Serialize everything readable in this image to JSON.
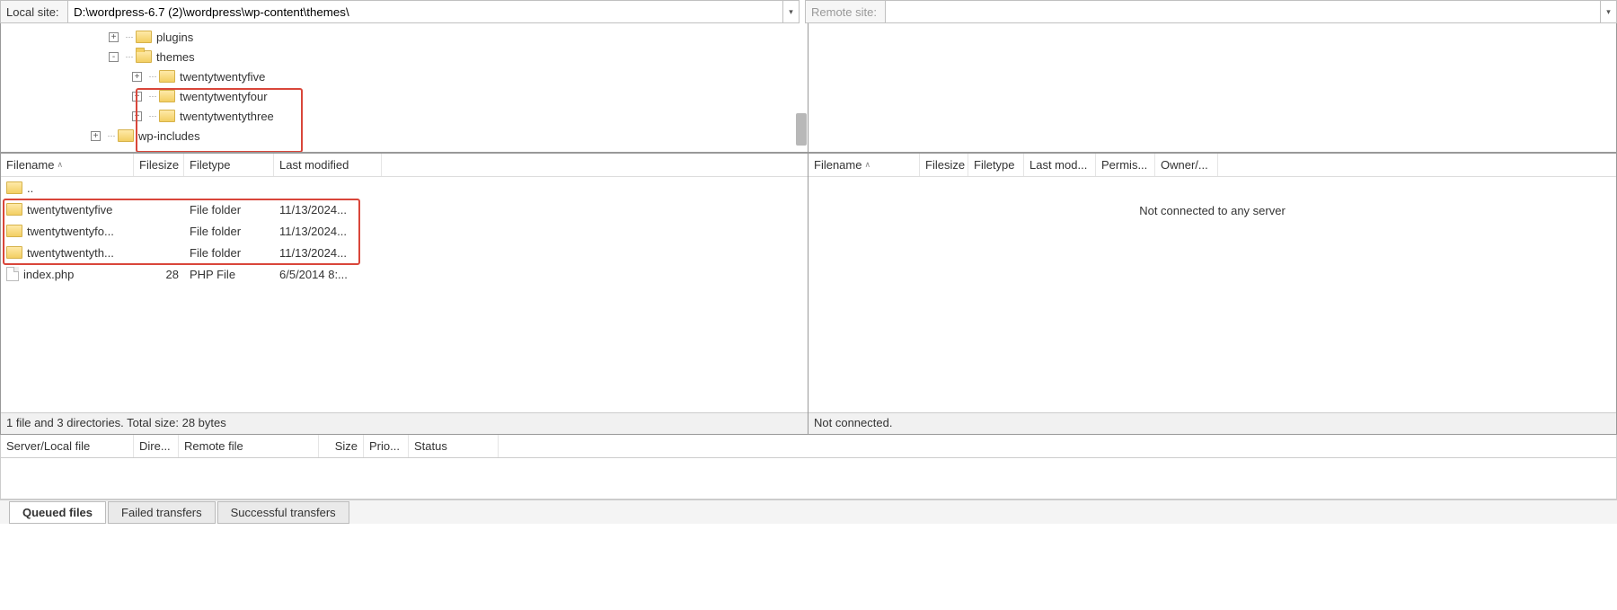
{
  "local": {
    "label": "Local site:",
    "path": "D:\\wordpress-6.7 (2)\\wordpress\\wp-content\\themes\\",
    "tree": [
      {
        "indent": 120,
        "exp": "+",
        "name": "plugins",
        "open": false
      },
      {
        "indent": 120,
        "exp": "-",
        "name": "themes",
        "open": true
      },
      {
        "indent": 146,
        "exp": "+",
        "name": "twentytwentyfive",
        "open": false
      },
      {
        "indent": 146,
        "exp": "+",
        "name": "twentytwentyfour",
        "open": false
      },
      {
        "indent": 146,
        "exp": "+",
        "name": "twentytwentythree",
        "open": false
      },
      {
        "indent": 100,
        "exp": "+",
        "name": "wp-includes",
        "open": false
      }
    ],
    "cols": {
      "filename": "Filename",
      "filesize": "Filesize",
      "filetype": "Filetype",
      "lastmod": "Last modified"
    },
    "rows": [
      {
        "icon": "folder",
        "name": "..",
        "size": "",
        "type": "",
        "mod": ""
      },
      {
        "icon": "folder",
        "name": "twentytwentyfive",
        "size": "",
        "type": "File folder",
        "mod": "11/13/2024..."
      },
      {
        "icon": "folder",
        "name": "twentytwentyfo...",
        "size": "",
        "type": "File folder",
        "mod": "11/13/2024..."
      },
      {
        "icon": "folder",
        "name": "twentytwentyth...",
        "size": "",
        "type": "File folder",
        "mod": "11/13/2024..."
      },
      {
        "icon": "file",
        "name": "index.php",
        "size": "28",
        "type": "PHP File",
        "mod": "6/5/2014 8:..."
      }
    ],
    "status": "1 file and 3 directories. Total size: 28 bytes"
  },
  "remote": {
    "label": "Remote site:",
    "path": "",
    "cols": {
      "filename": "Filename",
      "filesize": "Filesize",
      "filetype": "Filetype",
      "lastmod": "Last mod...",
      "permis": "Permis...",
      "owner": "Owner/..."
    },
    "empty_msg": "Not connected to any server",
    "status": "Not connected."
  },
  "queue": {
    "cols": {
      "server": "Server/Local file",
      "dir": "Dire...",
      "remote": "Remote file",
      "size": "Size",
      "prio": "Prio...",
      "status": "Status"
    }
  },
  "tabs": {
    "queued": "Queued files",
    "failed": "Failed transfers",
    "success": "Successful transfers"
  }
}
